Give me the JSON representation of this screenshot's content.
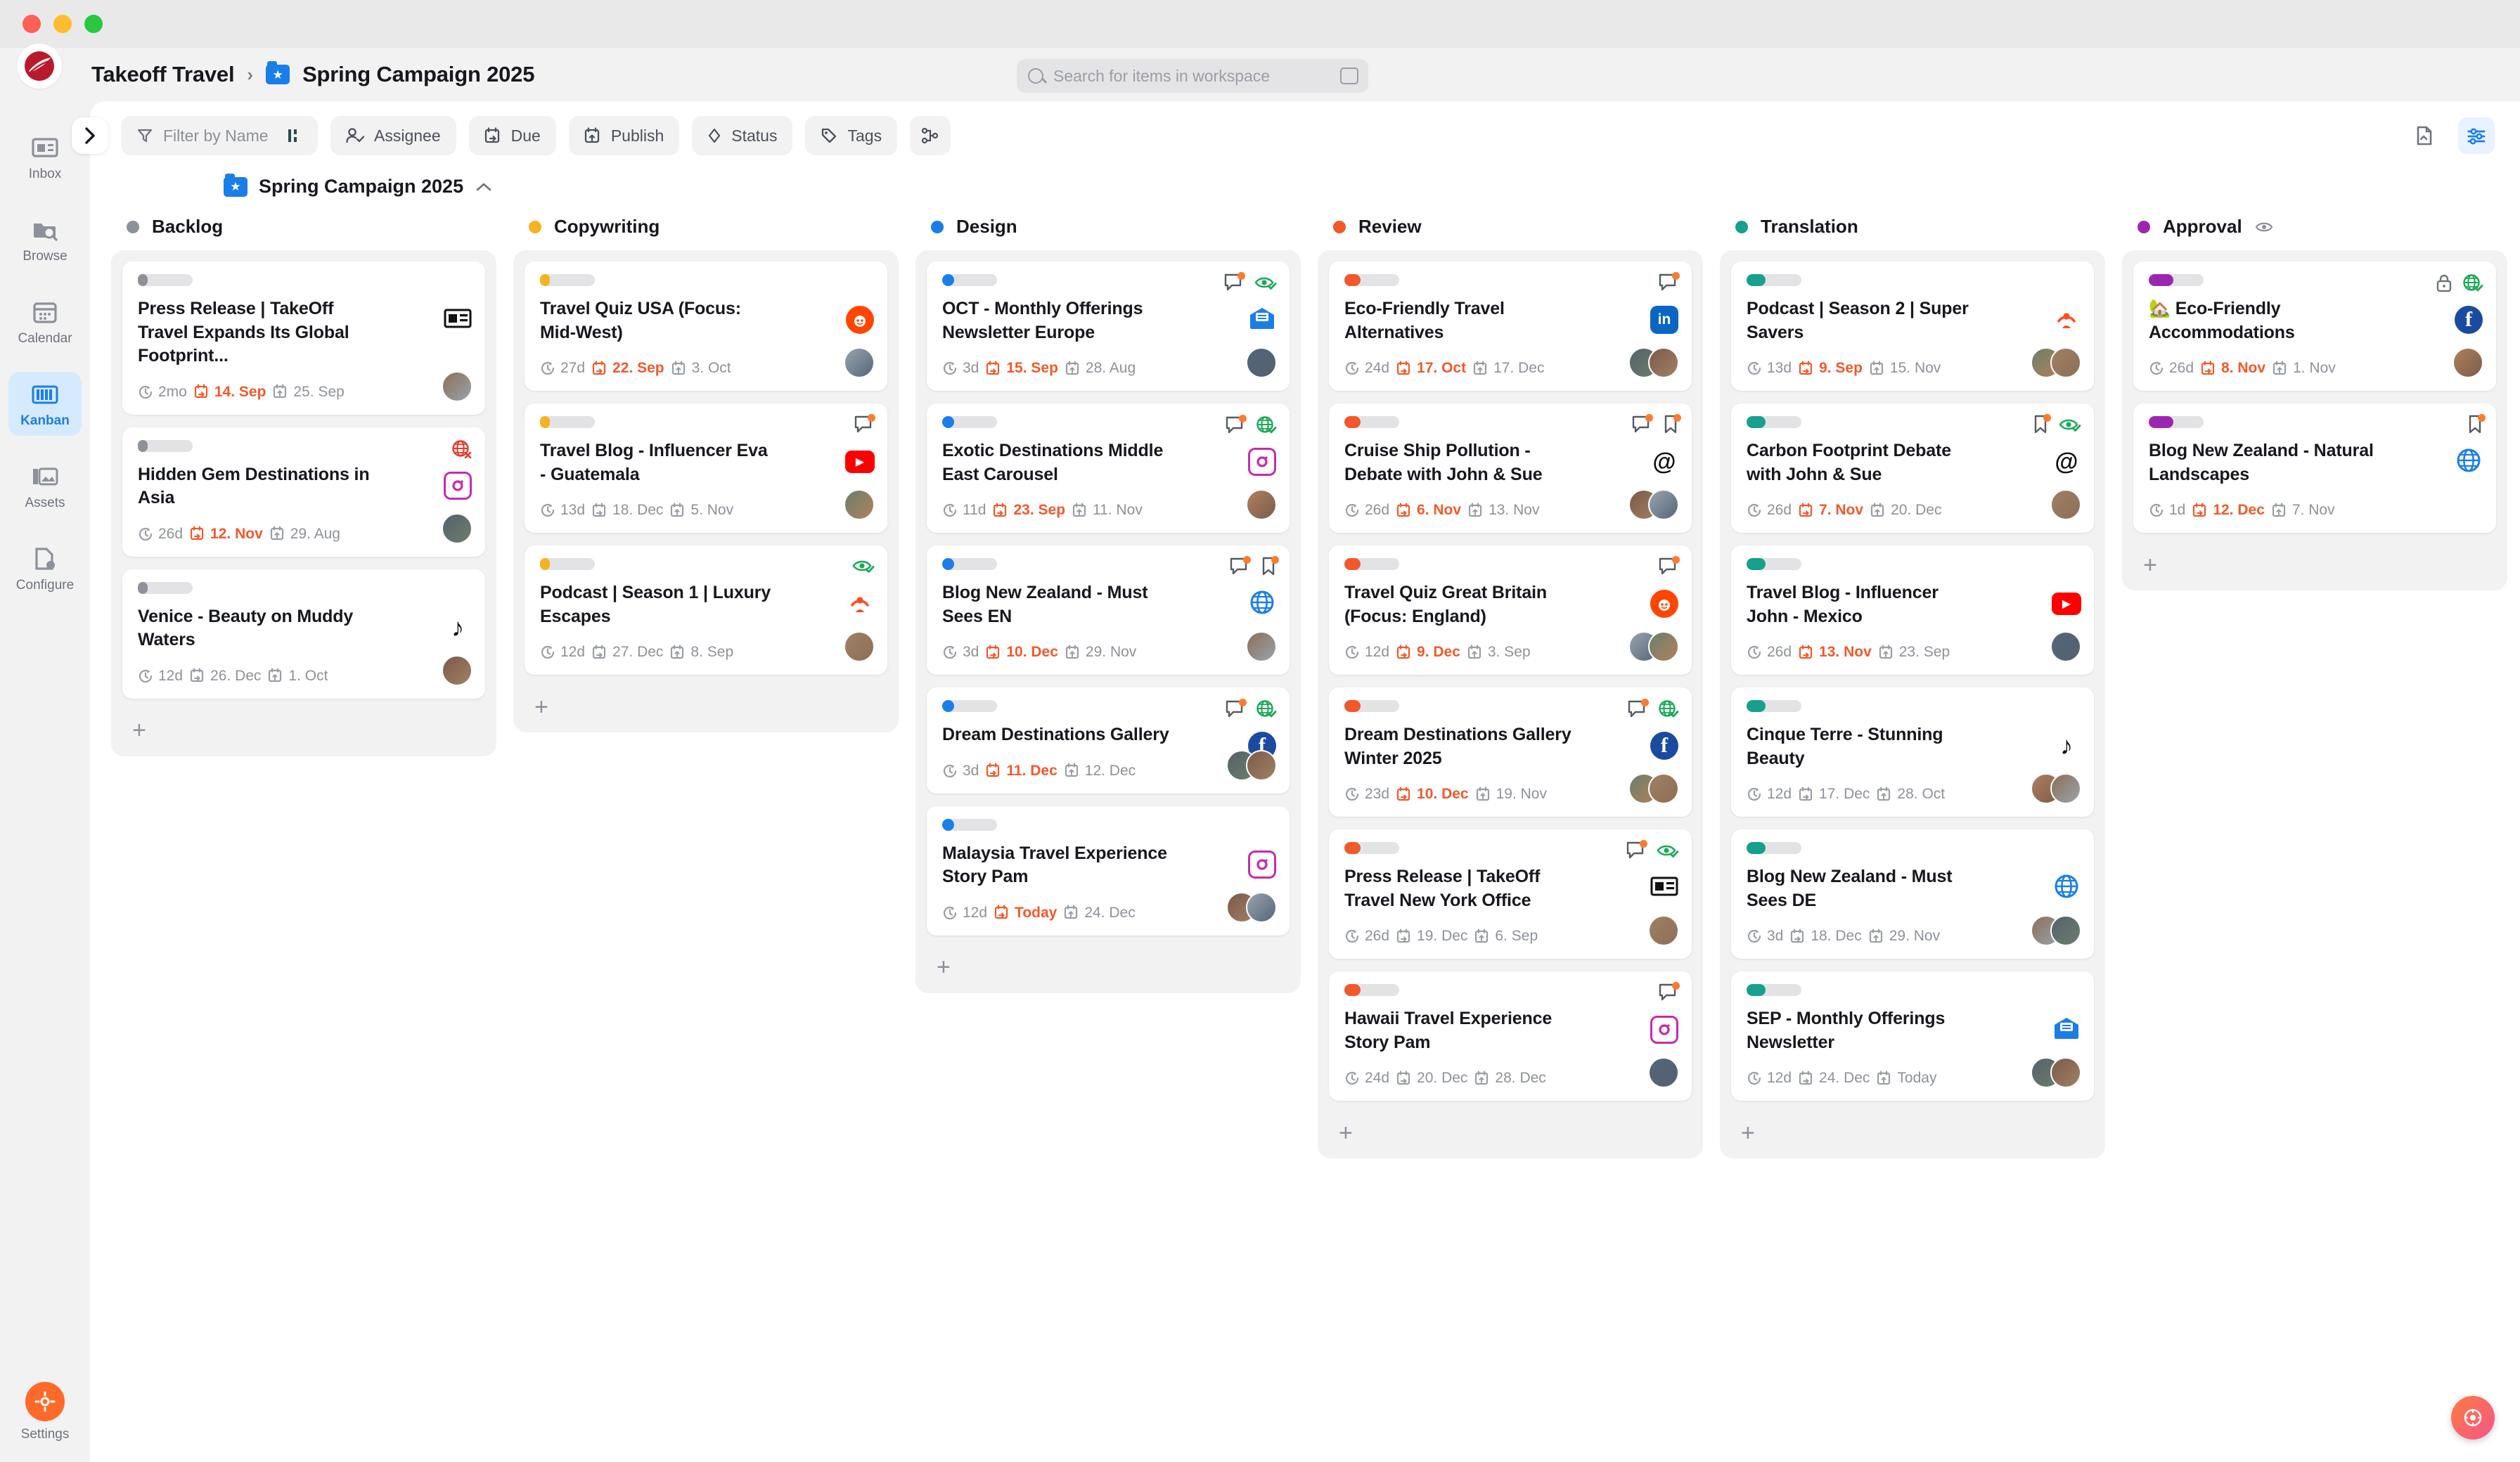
{
  "window": {
    "traffic_lights": [
      "close",
      "minimize",
      "maximize"
    ]
  },
  "header": {
    "workspace": "Takeoff Travel",
    "separator": "›",
    "project": "Spring Campaign 2025",
    "search_placeholder": "Search for items in workspace"
  },
  "sidebar": {
    "items": [
      {
        "label": "Inbox",
        "icon": "inbox-icon",
        "active": false
      },
      {
        "label": "Browse",
        "icon": "browse-icon",
        "active": false
      },
      {
        "label": "Calendar",
        "icon": "calendar-icon",
        "active": false
      },
      {
        "label": "Kanban",
        "icon": "kanban-icon",
        "active": true
      },
      {
        "label": "Assets",
        "icon": "assets-icon",
        "active": false
      },
      {
        "label": "Configure",
        "icon": "configure-icon",
        "active": false
      }
    ],
    "bottom": {
      "label": "Settings",
      "icon": "settings-icon"
    }
  },
  "toolbar": {
    "filter_placeholder": "Filter by Name",
    "chips": [
      {
        "label": "Assignee",
        "icon": "assignee-icon"
      },
      {
        "label": "Due",
        "icon": "due-calendar-icon"
      },
      {
        "label": "Publish",
        "icon": "publish-calendar-icon"
      },
      {
        "label": "Status",
        "icon": "status-diamond-icon"
      },
      {
        "label": "Tags",
        "icon": "tag-icon"
      }
    ]
  },
  "board": {
    "title": "Spring Campaign 2025",
    "columns": [
      {
        "name": "Backlog",
        "color": "#8d9199",
        "watch": false,
        "add_label": "+",
        "cards": [
          {
            "title": "Press Release | TakeOff Travel Expands Its Global Footprint...",
            "progress_color": "#8d9199",
            "progress_pct": 18,
            "age": "2mo",
            "due": "14. Sep",
            "due_overdue": true,
            "publish": "25. Sep",
            "icons": [],
            "channel": "news-icon",
            "avatars": 1
          },
          {
            "title": "Hidden Gem Destinations in Asia",
            "progress_color": "#8d9199",
            "progress_pct": 18,
            "age": "26d",
            "due": "12. Nov",
            "due_overdue": true,
            "publish": "29. Aug",
            "icons": [
              "globe-red-icon"
            ],
            "channel": "instagram-icon",
            "avatars": 1
          },
          {
            "title": "Venice - Beauty on Muddy Waters",
            "progress_color": "#8d9199",
            "progress_pct": 18,
            "age": "12d",
            "due": "26. Dec",
            "due_overdue": false,
            "publish": "1. Oct",
            "icons": [],
            "channel": "tiktok-icon",
            "avatars": 1
          }
        ]
      },
      {
        "name": "Copywriting",
        "color": "#f5b223",
        "watch": false,
        "add_label": "+",
        "cards": [
          {
            "title": "Travel Quiz USA (Focus: Mid-West)",
            "progress_color": "#f5b223",
            "progress_pct": 18,
            "age": "27d",
            "due": "22. Sep",
            "due_overdue": true,
            "publish": "3. Oct",
            "icons": [],
            "channel": "reddit-icon",
            "avatars": 1
          },
          {
            "title": "Travel Blog - Influencer Eva - Guatemala",
            "progress_color": "#f5b223",
            "progress_pct": 18,
            "age": "13d",
            "due": "18. Dec",
            "due_overdue": false,
            "publish": "5. Nov",
            "icons": [
              "comment-icon"
            ],
            "channel": "youtube-icon",
            "avatars": 1
          },
          {
            "title": "Podcast | Season 1 | Luxury Escapes",
            "progress_color": "#f5b223",
            "progress_pct": 18,
            "age": "12d",
            "due": "27. Dec",
            "due_overdue": false,
            "publish": "8. Sep",
            "icons": [
              "eye-check-icon"
            ],
            "channel": "podcast-icon",
            "avatars": 1
          }
        ]
      },
      {
        "name": "Design",
        "color": "#1a7ee8",
        "watch": false,
        "add_label": "+",
        "cards": [
          {
            "title": "OCT - Monthly Offerings Newsletter Europe",
            "progress_color": "#1a7ee8",
            "progress_pct": 22,
            "age": "3d",
            "due": "15. Sep",
            "due_overdue": true,
            "publish": "28. Aug",
            "icons": [
              "comment-icon",
              "eye-check-icon"
            ],
            "channel": "newsletter-icon",
            "avatars": 1
          },
          {
            "title": "Exotic Destinations Middle East Carousel",
            "progress_color": "#1a7ee8",
            "progress_pct": 22,
            "age": "11d",
            "due": "23. Sep",
            "due_overdue": true,
            "publish": "11. Nov",
            "icons": [
              "comment-icon",
              "globe-check-icon"
            ],
            "channel": "instagram-icon",
            "avatars": 1
          },
          {
            "title": "Blog New Zealand - Must Sees EN",
            "progress_color": "#1a7ee8",
            "progress_pct": 22,
            "age": "3d",
            "due": "10. Dec",
            "due_overdue": true,
            "publish": "29. Nov",
            "icons": [
              "comment-icon",
              "bookmark-icon"
            ],
            "channel": "globe-blue-icon",
            "avatars": 1
          },
          {
            "title": "Dream Destinations Gallery",
            "progress_color": "#1a7ee8",
            "progress_pct": 22,
            "age": "3d",
            "due": "11. Dec",
            "due_overdue": true,
            "publish": "12. Dec",
            "icons": [
              "comment-icon",
              "globe-check-icon"
            ],
            "channel": "facebook-icon",
            "avatars": 2
          },
          {
            "title": "Malaysia Travel Experience Story Pam",
            "progress_color": "#1a7ee8",
            "progress_pct": 22,
            "age": "12d",
            "due": "Today",
            "due_overdue": true,
            "publish": "24. Dec",
            "icons": [],
            "channel": "instagram-icon",
            "avatars": 2
          }
        ]
      },
      {
        "name": "Review",
        "color": "#f1592a",
        "watch": false,
        "add_label": "+",
        "cards": [
          {
            "title": "Eco-Friendly Travel Alternatives",
            "progress_color": "#f1592a",
            "progress_pct": 30,
            "age": "24d",
            "due": "17. Oct",
            "due_overdue": true,
            "publish": "17. Dec",
            "icons": [
              "comment-icon"
            ],
            "channel": "linkedin-icon",
            "avatars": 2,
            "inline_channel": true
          },
          {
            "title": "Cruise Ship Pollution - Debate with John & Sue",
            "progress_color": "#f1592a",
            "progress_pct": 30,
            "age": "26d",
            "due": "6. Nov",
            "due_overdue": true,
            "publish": "13. Nov",
            "icons": [
              "comment-icon",
              "bookmark-icon"
            ],
            "channel": "threads-icon",
            "avatars": 2
          },
          {
            "title": "Travel Quiz Great Britain (Focus: England)",
            "progress_color": "#f1592a",
            "progress_pct": 30,
            "age": "12d",
            "due": "9. Dec",
            "due_overdue": true,
            "publish": "3. Sep",
            "icons": [
              "comment-icon"
            ],
            "channel": "reddit-icon",
            "avatars": 2
          },
          {
            "title": "Dream Destinations Gallery Winter 2025",
            "progress_color": "#f1592a",
            "progress_pct": 30,
            "age": "23d",
            "due": "10. Dec",
            "due_overdue": true,
            "publish": "19. Nov",
            "icons": [
              "comment-icon",
              "globe-check-icon"
            ],
            "channel": "facebook-icon",
            "avatars": 2
          },
          {
            "title": "Press Release | TakeOff Travel New York Office",
            "progress_color": "#f1592a",
            "progress_pct": 30,
            "age": "26d",
            "due": "19. Dec",
            "due_overdue": false,
            "publish": "6. Sep",
            "icons": [
              "comment-icon",
              "eye-check-icon"
            ],
            "channel": "news-icon",
            "avatars": 1
          },
          {
            "title": "Hawaii Travel Experience Story Pam",
            "progress_color": "#f1592a",
            "progress_pct": 30,
            "age": "24d",
            "due": "20. Dec",
            "due_overdue": false,
            "publish": "28. Dec",
            "icons": [
              "comment-icon"
            ],
            "channel": "instagram-icon",
            "avatars": 1
          }
        ]
      },
      {
        "name": "Translation",
        "color": "#17a08c",
        "watch": false,
        "add_label": "+",
        "cards": [
          {
            "title": "Podcast | Season 2 | Super Savers",
            "progress_color": "#17a08c",
            "progress_pct": 35,
            "age": "13d",
            "due": "9. Sep",
            "due_overdue": true,
            "publish": "15. Nov",
            "icons": [],
            "channel": "podcast-icon",
            "avatars": 2
          },
          {
            "title": "Carbon Footprint Debate with John & Sue",
            "progress_color": "#17a08c",
            "progress_pct": 35,
            "age": "26d",
            "due": "7. Nov",
            "due_overdue": true,
            "publish": "20. Dec",
            "icons": [
              "bookmark-icon",
              "eye-check-icon"
            ],
            "channel": "threads-icon",
            "avatars": 1
          },
          {
            "title": "Travel Blog - Influencer John - Mexico",
            "progress_color": "#17a08c",
            "progress_pct": 35,
            "age": "26d",
            "due": "13. Nov",
            "due_overdue": true,
            "publish": "23. Sep",
            "icons": [],
            "channel": "youtube-icon",
            "avatars": 1
          },
          {
            "title": "Cinque Terre - Stunning Beauty",
            "progress_color": "#17a08c",
            "progress_pct": 35,
            "age": "12d",
            "due": "17. Dec",
            "due_overdue": false,
            "publish": "28. Oct",
            "icons": [],
            "channel": "tiktok-icon",
            "avatars": 2
          },
          {
            "title": "Blog New Zealand - Must Sees DE",
            "progress_color": "#17a08c",
            "progress_pct": 35,
            "age": "3d",
            "due": "18. Dec",
            "due_overdue": false,
            "publish": "29. Nov",
            "icons": [],
            "channel": "globe-blue-icon",
            "avatars": 2
          },
          {
            "title": "SEP - Monthly Offerings Newsletter",
            "progress_color": "#17a08c",
            "progress_pct": 35,
            "age": "12d",
            "due": "24. Dec",
            "due_overdue": false,
            "publish": "Today",
            "icons": [],
            "channel": "newsletter-icon",
            "avatars": 2
          }
        ]
      },
      {
        "name": "Approval",
        "color": "#9b27b0",
        "watch": true,
        "add_label": "+",
        "cards": [
          {
            "title": "🏡 Eco-Friendly Accommodations",
            "progress_color": "#9b27b0",
            "progress_pct": 45,
            "age": "26d",
            "due": "8. Nov",
            "due_overdue": true,
            "publish": "1. Nov",
            "icons": [
              "lock-icon",
              "globe-check-icon"
            ],
            "channel": "facebook-icon",
            "avatars": 1
          },
          {
            "title": "Blog New Zealand - Natural Landscapes",
            "progress_color": "#9b27b0",
            "progress_pct": 45,
            "age": "1d",
            "due": "12. Dec",
            "due_overdue": true,
            "publish": "7. Nov",
            "icons": [
              "bookmark-icon"
            ],
            "channel": "globe-blue-icon",
            "avatars": 0
          }
        ]
      }
    ]
  }
}
